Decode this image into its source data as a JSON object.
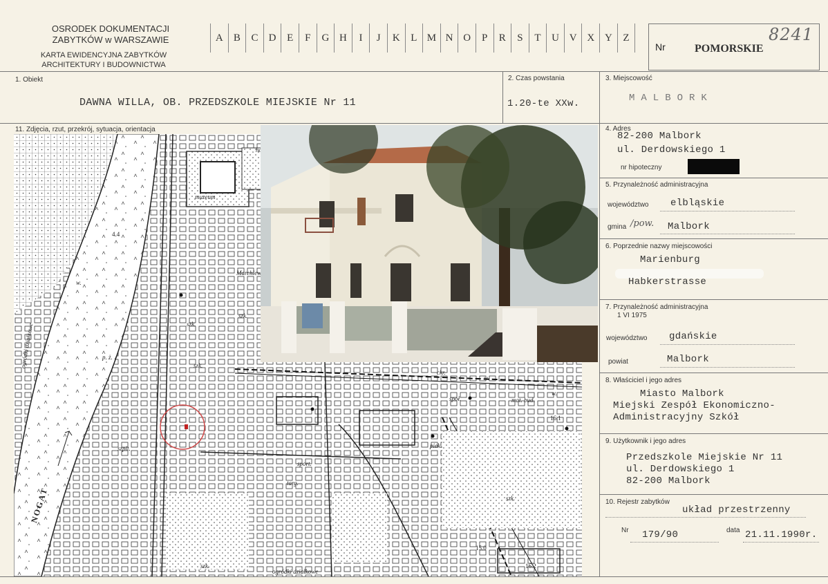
{
  "header": {
    "org_line1": "OSRODEK DOKUMENTACJI",
    "org_line2": "ZABYTKÓW w WARSZAWIE",
    "card_line1": "KARTA EWIDENCYJNA ZABYTKÓW",
    "card_line2": "ARCHITEKTURY I BUDOWNICTWA",
    "letters": [
      "A",
      "B",
      "C",
      "D",
      "E",
      "F",
      "G",
      "H",
      "I",
      "J",
      "K",
      "L",
      "M",
      "N",
      "O",
      "P",
      "R",
      "S",
      "T",
      "U",
      "V",
      "X",
      "Y",
      "Z"
    ],
    "nr_label": "Nr",
    "region": "POMORSKIE",
    "handwritten_number": "8241"
  },
  "fields": {
    "obiekt_label": "1. Obiekt",
    "obiekt_value": "DAWNA WILLA, OB. PRZEDSZKOLE MIEJSKIE Nr 11",
    "czas_label": "2. Czas powstania",
    "czas_value": "1.20-te XXw.",
    "miejscowosc_label": "3. Miejscowość",
    "miejscowosc_value": "M A L B O R K",
    "zdjecia_label": "11. Zdjęcia, rzut, przekrój, sytuacja, orientacja",
    "adres_label": "4. Adres",
    "adres_line1": "82-200 Malbork",
    "adres_line2": "ul. Derdowskiego 1",
    "hipoteczny_label": "nr hipoteczny",
    "przynaleznosc_label": "5. Przynależność administracyjna",
    "wojewodztwo_label": "województwo",
    "wojewodztwo_value": "elbląskie",
    "gmina_label": "gmina",
    "gmina_handwritten": "/pow.",
    "gmina_value": "Malbork",
    "poprzednie_label": "6. Poprzednie nazwy miejscowości",
    "poprzednie_line1": "Marienburg",
    "poprzednie_line2": "Habkerstrasse",
    "przynaleznosc2_label": "7. Przynależność administracyjna",
    "przynaleznosc2_date": "1 VI 1975",
    "wojewodztwo2_label": "województwo",
    "wojewodztwo2_value": "gdańskie",
    "powiat_label": "powiat",
    "powiat_value": "Malbork",
    "wlasciciel_label": "8. Właściciel i jego adres",
    "wlasciciel_line1": "Miasto Malbork",
    "wlasciciel_line2": "Miejski Zespół Ekonomiczno-",
    "wlasciciel_line3": "Administracyjny Szkół",
    "uzytkownik_label": "9. Użytkownik i jego adres",
    "uzytkownik_line1": "Przedszkole Miejskie Nr 11",
    "uzytkownik_line2": "ul. Derdowskiego 1",
    "uzytkownik_line3": "82-200 Malbork",
    "rejestr_label": "10. Rejestr zabytków",
    "rejestr_value": "układ przestrzenny",
    "nr_label": "Nr",
    "nr_value": "179/90",
    "data_label": "data",
    "data_value": "21.11.1990r."
  },
  "map": {
    "labels": {
      "muzeum": "muzeum",
      "hotel": "hot.",
      "w1": "w.",
      "szk1": "szk.",
      "szk2": "szk.",
      "szk3": "szk.",
      "pz": "p. ż.",
      "ogrodki": "ogródki działkowe",
      "szpit": "szpit.",
      "sport": "sport.",
      "targ": "targ.",
      "piek": "piek.",
      "spoz": "społ.",
      "matbud": "mat. bud.",
      "ckr": "ckr.",
      "nogat": "NOGAT",
      "szk4": "szk.",
      "szk5": "szk.",
      "ogrodki2": "ogródki działkowe",
      "num44": "4.4",
      "num150": "15.0",
      "num162": "16.2",
      "num161": "16.1",
      "marchlew": "Marchlew.",
      "w2": "w.",
      "w3": "w.",
      "photo_no": "1."
    }
  }
}
